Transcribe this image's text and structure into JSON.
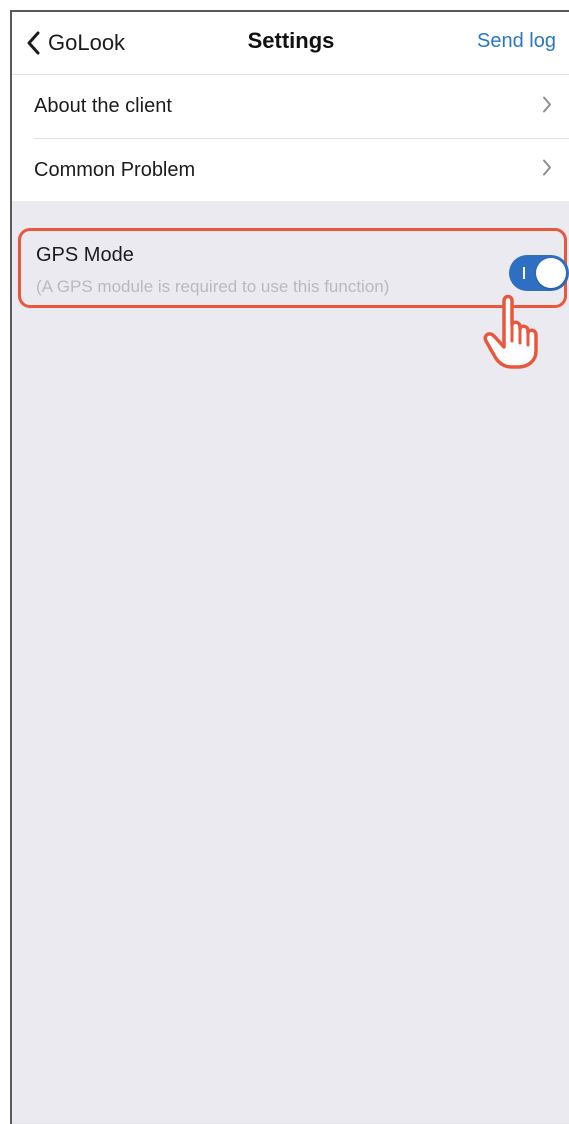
{
  "header": {
    "back_label": "GoLook",
    "title": "Settings",
    "action_label": "Send log"
  },
  "menu": {
    "items": [
      {
        "label": "About the client"
      },
      {
        "label": "Common Problem"
      }
    ]
  },
  "gps": {
    "title": "GPS Mode",
    "subtitle": "(A GPS module is required to use this function)",
    "toggle_state": "on",
    "toggle_color": "#2e6fc4",
    "highlight_color": "#e9573c"
  },
  "icons": {
    "back": "chevron-left-icon",
    "row_chevron": "chevron-right-icon",
    "pointer": "pointing-hand-icon"
  }
}
